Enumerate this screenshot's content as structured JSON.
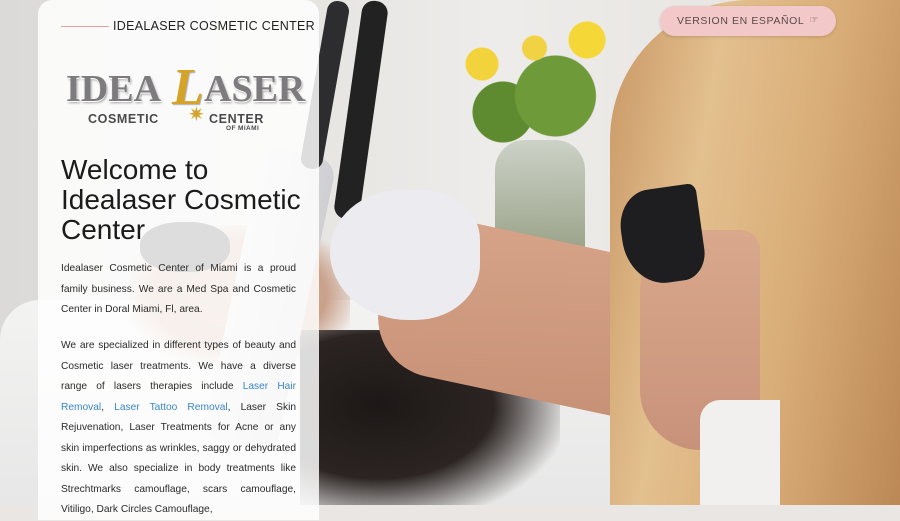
{
  "header": {
    "center_name": "IDEALASER COSMETIC CENTER",
    "language_button": "VERSION EN ESPAÑOL",
    "language_icon": "hand-pointer-icon"
  },
  "logo": {
    "idea": "IDEA",
    "l": "L",
    "aser": "ASER",
    "cosmetic": "COSMETIC",
    "center": "CENTER",
    "of_miami": "OF MIAMI",
    "accent_color": "#d4a327",
    "text_color": "#7d7b7d"
  },
  "main": {
    "heading": "Welcome to Idealaser Cosmetic Center",
    "paragraph1": "Idealaser Cosmetic Center of Miami is a proud family business. We are a Med Spa and Cosmetic Center in Doral Miami, Fl, area.",
    "paragraph2": {
      "text_a": "We are specialized in different types of beauty and Cosmetic laser treatments. We have a diverse range of lasers therapies include ",
      "link_hair": "Laser Hair Removal",
      "sep": ", ",
      "link_tattoo": "Laser Tattoo Removal",
      "text_b": ", Laser Skin Rejuvenation, Laser Treatments for Acne or any skin imperfections as wrinkles, saggy or dehydrated skin. We also specialize in body treatments like Strechtmarks camouflage, scars camouflage, Vitiligo, Dark Circles Camouflage,"
    }
  },
  "colors": {
    "button_bg": "#f3c8c9",
    "link": "#3a86c8",
    "rule": "#e7a0a2"
  }
}
